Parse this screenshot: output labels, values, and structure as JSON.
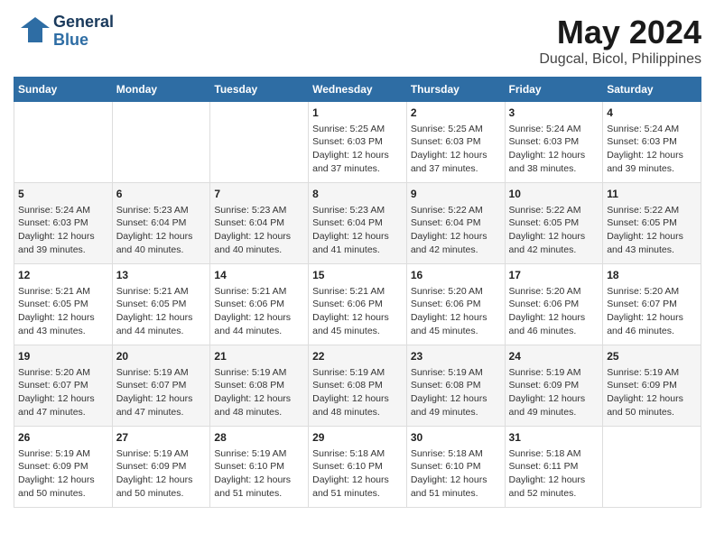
{
  "header": {
    "logo_line1": "General",
    "logo_line2": "Blue",
    "title": "May 2024",
    "subtitle": "Dugcal, Bicol, Philippines"
  },
  "weekdays": [
    "Sunday",
    "Monday",
    "Tuesday",
    "Wednesday",
    "Thursday",
    "Friday",
    "Saturday"
  ],
  "weeks": [
    [
      {
        "day": "",
        "info": ""
      },
      {
        "day": "",
        "info": ""
      },
      {
        "day": "",
        "info": ""
      },
      {
        "day": "1",
        "info": "Sunrise: 5:25 AM\nSunset: 6:03 PM\nDaylight: 12 hours\nand 37 minutes."
      },
      {
        "day": "2",
        "info": "Sunrise: 5:25 AM\nSunset: 6:03 PM\nDaylight: 12 hours\nand 37 minutes."
      },
      {
        "day": "3",
        "info": "Sunrise: 5:24 AM\nSunset: 6:03 PM\nDaylight: 12 hours\nand 38 minutes."
      },
      {
        "day": "4",
        "info": "Sunrise: 5:24 AM\nSunset: 6:03 PM\nDaylight: 12 hours\nand 39 minutes."
      }
    ],
    [
      {
        "day": "5",
        "info": "Sunrise: 5:24 AM\nSunset: 6:03 PM\nDaylight: 12 hours\nand 39 minutes."
      },
      {
        "day": "6",
        "info": "Sunrise: 5:23 AM\nSunset: 6:04 PM\nDaylight: 12 hours\nand 40 minutes."
      },
      {
        "day": "7",
        "info": "Sunrise: 5:23 AM\nSunset: 6:04 PM\nDaylight: 12 hours\nand 40 minutes."
      },
      {
        "day": "8",
        "info": "Sunrise: 5:23 AM\nSunset: 6:04 PM\nDaylight: 12 hours\nand 41 minutes."
      },
      {
        "day": "9",
        "info": "Sunrise: 5:22 AM\nSunset: 6:04 PM\nDaylight: 12 hours\nand 42 minutes."
      },
      {
        "day": "10",
        "info": "Sunrise: 5:22 AM\nSunset: 6:05 PM\nDaylight: 12 hours\nand 42 minutes."
      },
      {
        "day": "11",
        "info": "Sunrise: 5:22 AM\nSunset: 6:05 PM\nDaylight: 12 hours\nand 43 minutes."
      }
    ],
    [
      {
        "day": "12",
        "info": "Sunrise: 5:21 AM\nSunset: 6:05 PM\nDaylight: 12 hours\nand 43 minutes."
      },
      {
        "day": "13",
        "info": "Sunrise: 5:21 AM\nSunset: 6:05 PM\nDaylight: 12 hours\nand 44 minutes."
      },
      {
        "day": "14",
        "info": "Sunrise: 5:21 AM\nSunset: 6:06 PM\nDaylight: 12 hours\nand 44 minutes."
      },
      {
        "day": "15",
        "info": "Sunrise: 5:21 AM\nSunset: 6:06 PM\nDaylight: 12 hours\nand 45 minutes."
      },
      {
        "day": "16",
        "info": "Sunrise: 5:20 AM\nSunset: 6:06 PM\nDaylight: 12 hours\nand 45 minutes."
      },
      {
        "day": "17",
        "info": "Sunrise: 5:20 AM\nSunset: 6:06 PM\nDaylight: 12 hours\nand 46 minutes."
      },
      {
        "day": "18",
        "info": "Sunrise: 5:20 AM\nSunset: 6:07 PM\nDaylight: 12 hours\nand 46 minutes."
      }
    ],
    [
      {
        "day": "19",
        "info": "Sunrise: 5:20 AM\nSunset: 6:07 PM\nDaylight: 12 hours\nand 47 minutes."
      },
      {
        "day": "20",
        "info": "Sunrise: 5:19 AM\nSunset: 6:07 PM\nDaylight: 12 hours\nand 47 minutes."
      },
      {
        "day": "21",
        "info": "Sunrise: 5:19 AM\nSunset: 6:08 PM\nDaylight: 12 hours\nand 48 minutes."
      },
      {
        "day": "22",
        "info": "Sunrise: 5:19 AM\nSunset: 6:08 PM\nDaylight: 12 hours\nand 48 minutes."
      },
      {
        "day": "23",
        "info": "Sunrise: 5:19 AM\nSunset: 6:08 PM\nDaylight: 12 hours\nand 49 minutes."
      },
      {
        "day": "24",
        "info": "Sunrise: 5:19 AM\nSunset: 6:09 PM\nDaylight: 12 hours\nand 49 minutes."
      },
      {
        "day": "25",
        "info": "Sunrise: 5:19 AM\nSunset: 6:09 PM\nDaylight: 12 hours\nand 50 minutes."
      }
    ],
    [
      {
        "day": "26",
        "info": "Sunrise: 5:19 AM\nSunset: 6:09 PM\nDaylight: 12 hours\nand 50 minutes."
      },
      {
        "day": "27",
        "info": "Sunrise: 5:19 AM\nSunset: 6:09 PM\nDaylight: 12 hours\nand 50 minutes."
      },
      {
        "day": "28",
        "info": "Sunrise: 5:19 AM\nSunset: 6:10 PM\nDaylight: 12 hours\nand 51 minutes."
      },
      {
        "day": "29",
        "info": "Sunrise: 5:18 AM\nSunset: 6:10 PM\nDaylight: 12 hours\nand 51 minutes."
      },
      {
        "day": "30",
        "info": "Sunrise: 5:18 AM\nSunset: 6:10 PM\nDaylight: 12 hours\nand 51 minutes."
      },
      {
        "day": "31",
        "info": "Sunrise: 5:18 AM\nSunset: 6:11 PM\nDaylight: 12 hours\nand 52 minutes."
      },
      {
        "day": "",
        "info": ""
      }
    ]
  ]
}
